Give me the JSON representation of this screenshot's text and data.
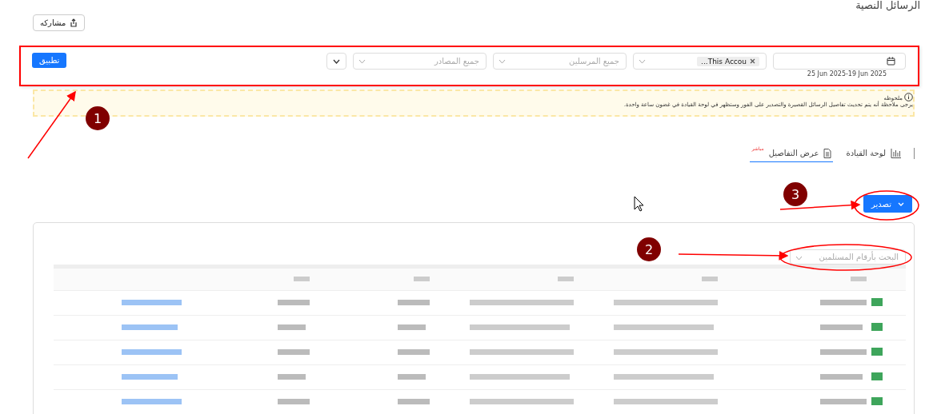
{
  "title": "الرسائل النصية",
  "share_button": {
    "label": "مشاركه"
  },
  "filters": {
    "date": {
      "range": "25 Jun 2025-19 Jun 2025"
    },
    "account": {
      "tags": [
        "This Accou..."
      ]
    },
    "senders": {
      "placeholder": "جميع المرسلين"
    },
    "sources": {
      "placeholder": "جميع المصادر"
    },
    "apply_button": "تطبيق"
  },
  "note": {
    "title": "ملحوظه",
    "text": "يرجى ملاحظة أنه يتم تحديث تفاصيل الرسائل القصيرة والتصدير على الفور وستظهر في لوحة القيادة في غضون ساعة واحدة."
  },
  "tabs": [
    {
      "label": "لوحة القيادة",
      "selected": false,
      "kind": "chart"
    },
    {
      "label": "عرض التفاصيل",
      "selected": true,
      "kind": "document",
      "badge": "مباشر"
    }
  ],
  "export_button": "تصدير",
  "search": {
    "placeholder": "البحث بأرقام المستلمين"
  },
  "annotations": [
    {
      "number": "1"
    },
    {
      "number": "2"
    },
    {
      "number": "3"
    }
  ]
}
